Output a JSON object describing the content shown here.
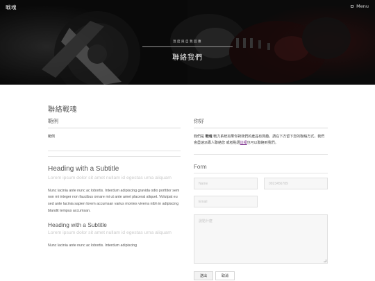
{
  "header": {
    "brand": "戰魂",
    "menu_label": "Menu",
    "menu_icon": "square-icon",
    "hero_subtitle": "溫度與自我回應",
    "hero_title": "聯絡我們"
  },
  "main": {
    "page_title": "聯絡戰魂",
    "left": {
      "section_title": "範例",
      "section_text": "範例",
      "heading1": "Heading with a Subtitle",
      "subtitle1": "Lorem ipsum dolor sit amet nullam id egestas urna aliquam",
      "paragraph1": "Nunc lacinia ante nunc ac lobortis. Interdum adipiscing gravida odio porttitor sem non mi integer non faucibus ornare mi ut ante amet placerat aliquet. Volutpat eu sed ante lacinia sapien lorem accumsan varius montes viverra nibh in adipiscing blandit tempus accumsan.",
      "heading2": "Heading with a Subtitle",
      "subtitle2": "Lorem ipsum dolor sit amet nullam id egestas urna aliquam",
      "paragraph2": "Nunc lacinia ante nunc ac lobortis. Interdum adipiscing"
    },
    "right": {
      "hello": "你好",
      "intro_pre": "我們是",
      "intro_bold": "戰魂",
      "intro_mid": "戰力系統如果你對我們的產品有興趣，請在下方留下您的聯絡方式，我們會盡速派專人聯絡您 或者點選",
      "intro_link": "這裡",
      "intro_post": "也可以聯絡到我們。",
      "form_title": "Form",
      "name_placeholder": "Name",
      "phone_placeholder": "0923456789",
      "email_placeholder": "Email",
      "message_placeholder": "說點什麼",
      "send_label": "送出",
      "cancel_label": "取消"
    }
  },
  "colors": {
    "hero_bg": "#141414",
    "link": "#7a2b8a",
    "field_bg": "#f7f7f7"
  }
}
